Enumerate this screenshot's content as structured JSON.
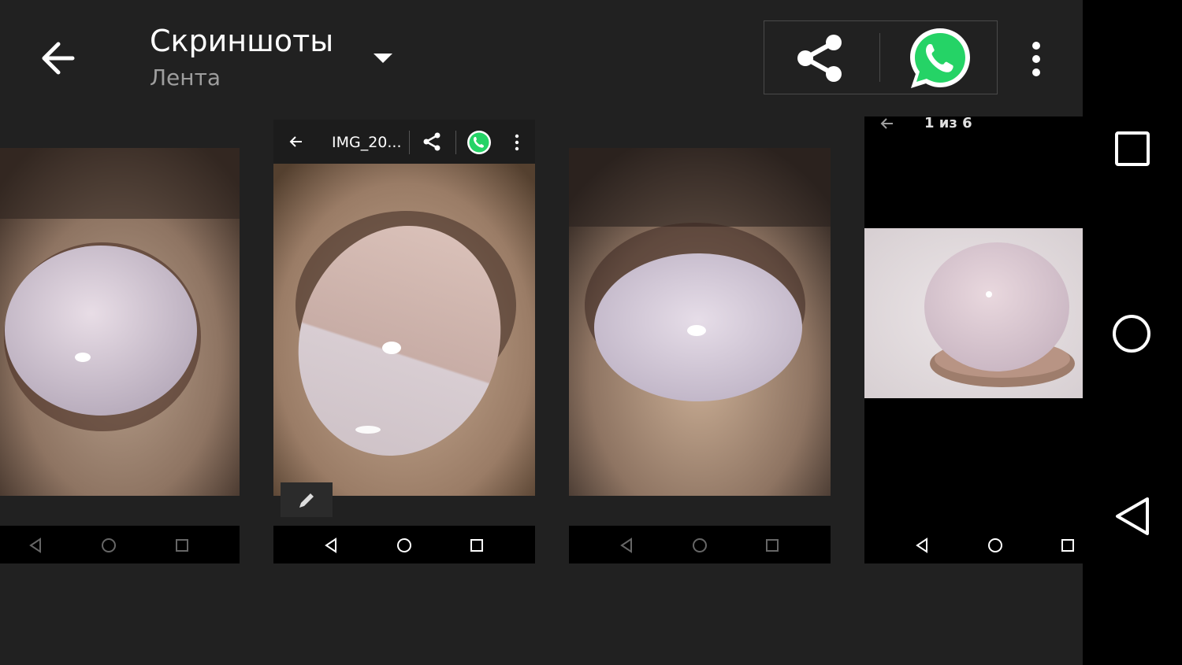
{
  "action_bar": {
    "title": "Скриншоты",
    "subtitle": "Лента",
    "back_icon": "arrow-left-icon",
    "dropdown_icon": "caret-down-icon",
    "share_icon": "share-icon",
    "whatsapp_icon": "whatsapp-icon",
    "more_icon": "more-vert-icon"
  },
  "cards": [
    {
      "position": "left-partial",
      "thumbnail_toolbar": null
    },
    {
      "position": "center",
      "thumbnail_toolbar": {
        "title": "IMG_20..."
      },
      "edit_icon": "pencil-icon"
    },
    {
      "position": "right"
    },
    {
      "position": "far-right",
      "counter": "1 из 6"
    }
  ],
  "system_nav": {
    "items": [
      "square-recents-icon",
      "circle-home-icon",
      "triangle-back-icon"
    ]
  },
  "colors": {
    "background": "#212121",
    "nav_background": "#000000",
    "whatsapp_green": "#25D366",
    "subtitle_gray": "#9e9e9e"
  }
}
